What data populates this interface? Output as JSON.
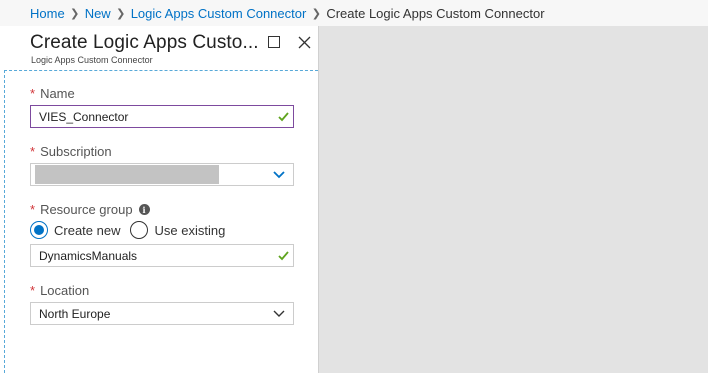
{
  "breadcrumb": {
    "items": [
      "Home",
      "New",
      "Logic Apps Custom Connector"
    ],
    "current": "Create Logic Apps Custom Connector"
  },
  "blade": {
    "title": "Create Logic Apps Custo...",
    "subtitle": "Logic Apps Custom Connector",
    "maximize_icon": "maximize-icon",
    "close_icon": "close-icon"
  },
  "form": {
    "required_marker": "*",
    "name": {
      "label": "Name",
      "value": "VIES_Connector",
      "status_icon": "checkmark-icon"
    },
    "subscription": {
      "label": "Subscription",
      "value": ""
    },
    "resource_group": {
      "label": "Resource group",
      "info_icon": "i",
      "options": [
        "Create new",
        "Use existing"
      ],
      "selected": "Create new",
      "value": "DynamicsManuals"
    },
    "location": {
      "label": "Location",
      "value": "North Europe"
    }
  },
  "colors": {
    "link": "#0072c6",
    "required": "#d13438",
    "valid_check": "#5fa41e",
    "focus_border": "#7d4a9e",
    "radio_selected": "#0072c6",
    "page_background": "#e3e3e3"
  }
}
